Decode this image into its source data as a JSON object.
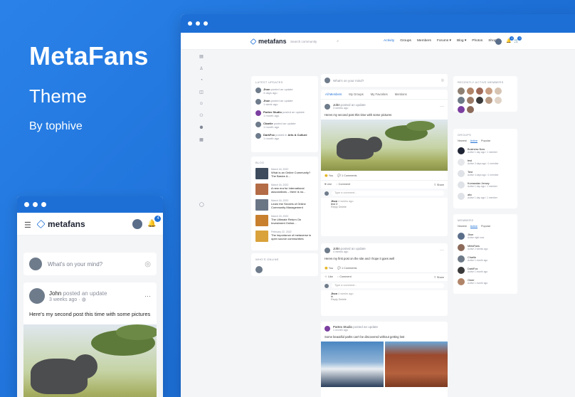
{
  "brand": {
    "title": "MetaFans",
    "subtitle": "Theme",
    "byline": "By tophive"
  },
  "desktop": {
    "logo": "metafans",
    "search_placeholder": "Search community",
    "menu": [
      "Activity",
      "Groups",
      "Members",
      "Forums ▾",
      "Blog ▾",
      "Photos",
      "Shop ▾"
    ],
    "notification_count": "4",
    "cart_count": "0",
    "latest_updates": {
      "title": "LATEST UPDATES",
      "items": [
        {
          "name": "Jhon",
          "action": "posted an update",
          "time": "3 days ago"
        },
        {
          "name": "Jhon",
          "action": "posted an update",
          "time": "1 week ago"
        },
        {
          "name": "Partex Studio",
          "action": "posted an update",
          "time": "1 month ago"
        },
        {
          "name": "Charlie",
          "action": "posted an update",
          "time": "1 month ago"
        },
        {
          "name": "DarkFox",
          "action": "posted in",
          "group": "Arts & Culture",
          "time": "1 month ago"
        }
      ]
    },
    "blog": {
      "title": "BLOG",
      "items": [
        {
          "date": "March 16, 2022",
          "title": "What is an Online Community? The Basics &..."
        },
        {
          "date": "March 16, 2022",
          "title": "A new era for international associations – there is no..."
        },
        {
          "date": "March 16, 2022",
          "title": "Learn the Secrets of Online Community Management"
        },
        {
          "date": "March 15, 2022",
          "title": "The Ultimate Return On Investment Online..."
        },
        {
          "date": "February 22, 2022",
          "title": "The importance of metaverse in open source communities"
        }
      ]
    },
    "whos_online": {
      "title": "WHO'S ONLINE"
    },
    "feed": {
      "composer_placeholder": "What's on your mind?",
      "tabs": [
        "All Members",
        "My Groups",
        "My Favorites",
        "Mentions"
      ],
      "posts": [
        {
          "name": "John",
          "action": "posted an update",
          "time": "3 weeks ago",
          "text": "Heres my second post this time with some pictures",
          "reactions": "You",
          "comments_count": "1 Comments",
          "like_label": "Like",
          "comment_label": "Comment",
          "share_label": "Share",
          "comment_placeholder": "Type a comment...",
          "comment": {
            "name": "Jhon",
            "time": "4 weeks ago",
            "text": "test 3",
            "reply": "Reply",
            "delete": "Delete"
          }
        },
        {
          "name": "John",
          "action": "posted an update",
          "time": "4 weeks ago",
          "text": "Heres my first post on the site and I hope it goes well",
          "reactions": "You",
          "comments_count": "1 Comments",
          "like_label": "Like",
          "comment_label": "Comment",
          "share_label": "Share",
          "comment_placeholder": "Type a comment...",
          "comment": {
            "name": "Jhon",
            "time": "4 weeks ago",
            "text": "hi",
            "reply": "Reply",
            "delete": "Delete"
          }
        },
        {
          "name": "Partex Studio",
          "action": "posted an update",
          "time": "1 month ago",
          "text": "Some beautiful paths can't be discovered without getting lost"
        }
      ]
    },
    "recent_members": {
      "title": "RECENTLY ACTIVE MEMBERS"
    },
    "groups": {
      "title": "GROUPS",
      "tabs": [
        "Newest",
        "Active",
        "Popular"
      ],
      "items": [
        {
          "name": "Business Now",
          "sub": "Active 1 day ago / 1 member"
        },
        {
          "name": "test",
          "sub": "Active 2 days ago / 1 member"
        },
        {
          "name": "Test",
          "sub": "Active 4 days ago / 1 member"
        },
        {
          "name": "Kumandan Jersey",
          "sub": "Active 1 day ago / 1 member"
        },
        {
          "name": "abc",
          "sub": "Active 1 day ago / 1 member"
        }
      ]
    },
    "members": {
      "title": "MEMBERS",
      "tabs": [
        "Newest",
        "Active",
        "Popular"
      ],
      "items": [
        {
          "name": "Jhon",
          "sub": "Active right now"
        },
        {
          "name": "MetaFans",
          "sub": "Active 2 weeks ago"
        },
        {
          "name": "Charlie",
          "sub": "Active 1 month ago"
        },
        {
          "name": "DarkFox",
          "sub": "Active 1 month ago"
        },
        {
          "name": "Omer",
          "sub": "Active 1 month ago"
        }
      ]
    }
  },
  "mobile": {
    "logo": "metafans",
    "notification_count": "4",
    "composer_placeholder": "What's on your mind?",
    "post": {
      "name": "John",
      "action": "posted an update",
      "time": "3 weeks ago",
      "separator": "·",
      "text": "Here's my second post this time with some pictures"
    }
  },
  "colors": {
    "brand_blue": "#1d6fd6",
    "background": "#f4f5f7"
  }
}
